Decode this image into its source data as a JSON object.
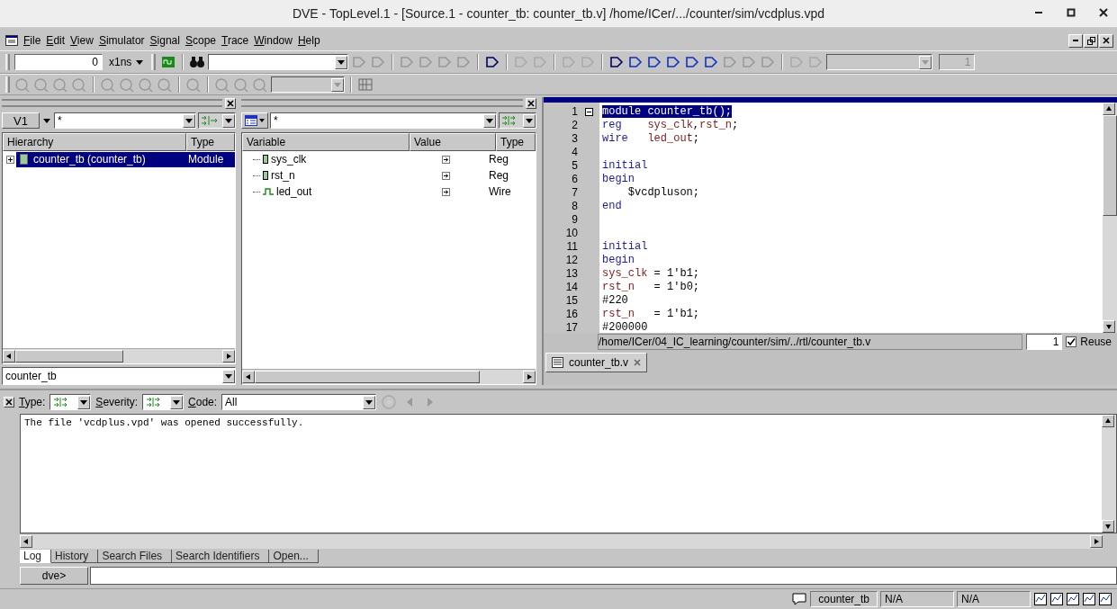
{
  "window": {
    "title": "DVE - TopLevel.1 - [Source.1 - counter_tb: counter_tb.v]  /home/ICer/.../counter/sim/vcdplus.vpd"
  },
  "menu": [
    {
      "label": "File"
    },
    {
      "label": "Edit"
    },
    {
      "label": "View"
    },
    {
      "label": "Simulator"
    },
    {
      "label": "Signal"
    },
    {
      "label": "Scope"
    },
    {
      "label": "Trace"
    },
    {
      "label": "Window"
    },
    {
      "label": "Help"
    }
  ],
  "toolbar": {
    "time": "0",
    "unit": "x1ns",
    "counter": "1"
  },
  "hierarchy": {
    "scope": "V1",
    "filter": "*",
    "columns": [
      "Hierarchy",
      "Type"
    ],
    "rows": [
      {
        "name": "counter_tb (counter_tb)",
        "type": "Module",
        "selected": true
      }
    ],
    "scope_combo": "counter_tb"
  },
  "variables": {
    "filter": "*",
    "columns": [
      "Variable",
      "Value",
      "Type"
    ],
    "rows": [
      {
        "name": "sys_clk",
        "kind": "reg",
        "type": "Reg"
      },
      {
        "name": "rst_n",
        "kind": "reg",
        "type": "Reg"
      },
      {
        "name": "led_out",
        "kind": "wire",
        "type": "Wire"
      }
    ]
  },
  "source": {
    "lines": [
      {
        "number": "1",
        "selected": true,
        "tokens": [
          {
            "kind": "kw",
            "text": "module"
          },
          {
            "kind": "plain",
            "text": " counter_tb();"
          }
        ]
      },
      {
        "number": "2",
        "selected": false,
        "tokens": [
          {
            "kind": "kw",
            "text": "reg    "
          },
          {
            "kind": "id",
            "text": "sys_clk"
          },
          {
            "kind": "plain",
            "text": ","
          },
          {
            "kind": "id",
            "text": "rst_n"
          },
          {
            "kind": "plain",
            "text": ";"
          }
        ]
      },
      {
        "number": "3",
        "selected": false,
        "tokens": [
          {
            "kind": "kw",
            "text": "wire   "
          },
          {
            "kind": "id",
            "text": "led_out"
          },
          {
            "kind": "plain",
            "text": ";"
          }
        ]
      },
      {
        "number": "4"
      },
      {
        "number": "5",
        "selected": false,
        "tokens": [
          {
            "kind": "kw",
            "text": "initial"
          }
        ]
      },
      {
        "number": "6",
        "selected": false,
        "tokens": [
          {
            "kind": "kw",
            "text": "begin"
          }
        ]
      },
      {
        "number": "7",
        "selected": false,
        "tokens": [
          {
            "kind": "plain",
            "text": "    $vcdpluson;"
          }
        ]
      },
      {
        "number": "8",
        "selected": false,
        "tokens": [
          {
            "kind": "kw",
            "text": "end"
          }
        ]
      },
      {
        "number": "9"
      },
      {
        "number": "10"
      },
      {
        "number": "11",
        "selected": false,
        "tokens": [
          {
            "kind": "kw",
            "text": "initial"
          }
        ]
      },
      {
        "number": "12",
        "selected": false,
        "tokens": [
          {
            "kind": "kw",
            "text": "begin"
          }
        ]
      },
      {
        "number": "13",
        "selected": false,
        "tokens": [
          {
            "kind": "id",
            "text": "sys_clk"
          },
          {
            "kind": "plain",
            "text": " = 1'b1;"
          }
        ]
      },
      {
        "number": "14",
        "selected": false,
        "tokens": [
          {
            "kind": "id",
            "text": "rst_n"
          },
          {
            "kind": "plain",
            "text": "   = 1'b0;"
          }
        ]
      },
      {
        "number": "15",
        "selected": false,
        "tokens": [
          {
            "kind": "plain",
            "text": "#220"
          }
        ]
      },
      {
        "number": "16",
        "selected": false,
        "tokens": [
          {
            "kind": "id",
            "text": "rst_n"
          },
          {
            "kind": "plain",
            "text": "   = 1'b1;"
          }
        ]
      },
      {
        "number": "17",
        "selected": false,
        "tokens": [
          {
            "kind": "plain",
            "text": "#200000"
          }
        ]
      }
    ],
    "path": "/home/ICer/04_IC_learning/counter/sim/../rtl/counter_tb.v",
    "line": "1",
    "reuse_label": "Reuse",
    "reuse_checked": true,
    "tabs": [
      {
        "label": "counter_tb.v",
        "selected": true
      }
    ]
  },
  "log": {
    "type_label": "Type:",
    "severity_label": "Severity:",
    "code_label": "Code:",
    "code_value": "All",
    "messages": [
      "The file 'vcdplus.vpd' was opened successfully."
    ],
    "tabs": [
      {
        "label": "Log",
        "selected": true
      },
      {
        "label": "History",
        "selected": false
      },
      {
        "label": "Search Files",
        "selected": false
      },
      {
        "label": "Search Identifiers",
        "selected": false
      },
      {
        "label": "Open...",
        "selected": false
      }
    ],
    "prompt": "dve>"
  },
  "status_bar": {
    "scope": "counter_tb",
    "fields": [
      "N/A",
      "N/A"
    ]
  }
}
